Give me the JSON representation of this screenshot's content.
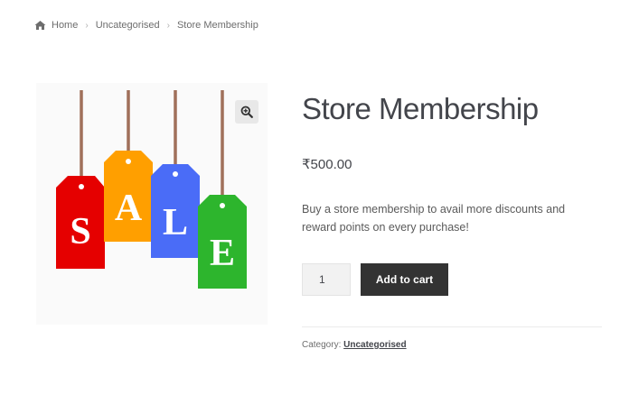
{
  "breadcrumb": {
    "home_icon": "home-icon",
    "items": [
      "Home",
      "Uncategorised",
      "Store Membership"
    ],
    "separator": "›"
  },
  "product": {
    "title": "Store Membership",
    "price": "₹500.00",
    "description": "Buy a store membership to avail more discounts and reward points on every purchase!",
    "image_letters": [
      "S",
      "A",
      "L",
      "E"
    ],
    "tag_colors": [
      "#e50000",
      "#ff9f00",
      "#4a6cf7",
      "#2db52d"
    ],
    "zoom_icon": "zoom-in-icon"
  },
  "cart": {
    "quantity": "1",
    "add_to_cart_label": "Add to cart"
  },
  "meta": {
    "category_label": "Category:",
    "category_value": "Uncategorised"
  }
}
